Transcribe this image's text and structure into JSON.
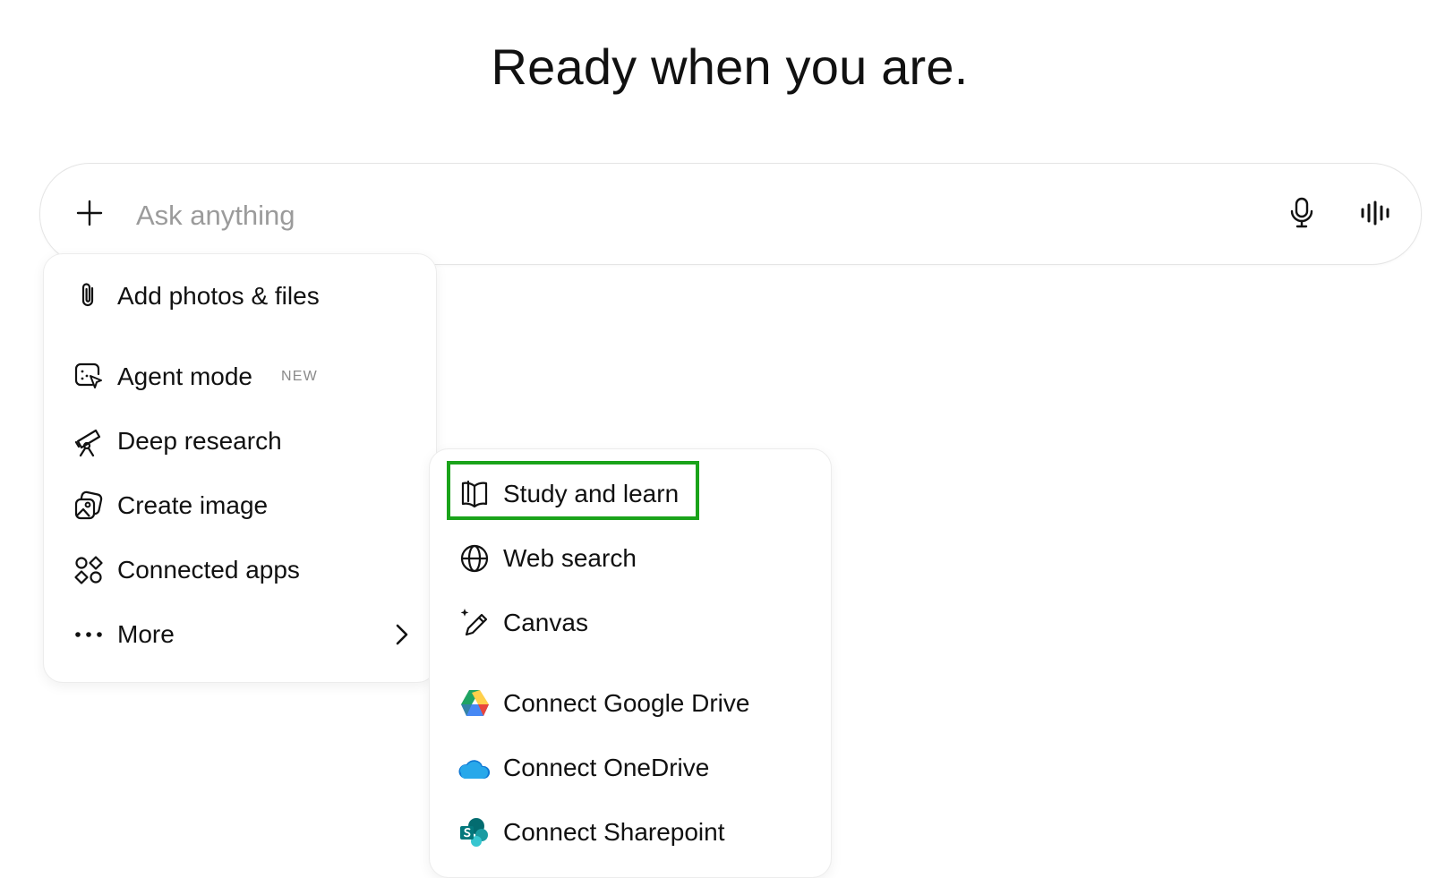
{
  "header": {
    "title": "Ready when you are."
  },
  "composer": {
    "placeholder": "Ask anything",
    "value": "",
    "plus_icon": "plus-icon",
    "mic_icon": "microphone-icon",
    "voice_icon": "voice-waveform-icon"
  },
  "menu": {
    "items": [
      {
        "label": "Add photos & files",
        "icon": "paperclip-icon"
      },
      {
        "label": "Agent mode",
        "icon": "agent-cursor-icon",
        "badge": "NEW"
      },
      {
        "label": "Deep research",
        "icon": "telescope-icon"
      },
      {
        "label": "Create image",
        "icon": "image-icon"
      },
      {
        "label": "Connected apps",
        "icon": "apps-icon"
      },
      {
        "label": "More",
        "icon": "ellipsis-icon",
        "chevron": "chevron-right-icon"
      }
    ]
  },
  "more_menu": {
    "items": [
      {
        "label": "Study and learn",
        "icon": "open-book-icon",
        "highlighted": true
      },
      {
        "label": "Web search",
        "icon": "globe-icon"
      },
      {
        "label": "Canvas",
        "icon": "pencil-sparkle-icon"
      },
      {
        "label": "Connect Google Drive",
        "icon": "google-drive-icon"
      },
      {
        "label": "Connect OneDrive",
        "icon": "onedrive-icon"
      },
      {
        "label": "Connect Sharepoint",
        "icon": "sharepoint-icon"
      }
    ]
  },
  "colors": {
    "highlight_border": "#1aa31a",
    "text": "#111111",
    "placeholder": "#9b9b9b",
    "badge": "#8a8a8a"
  }
}
